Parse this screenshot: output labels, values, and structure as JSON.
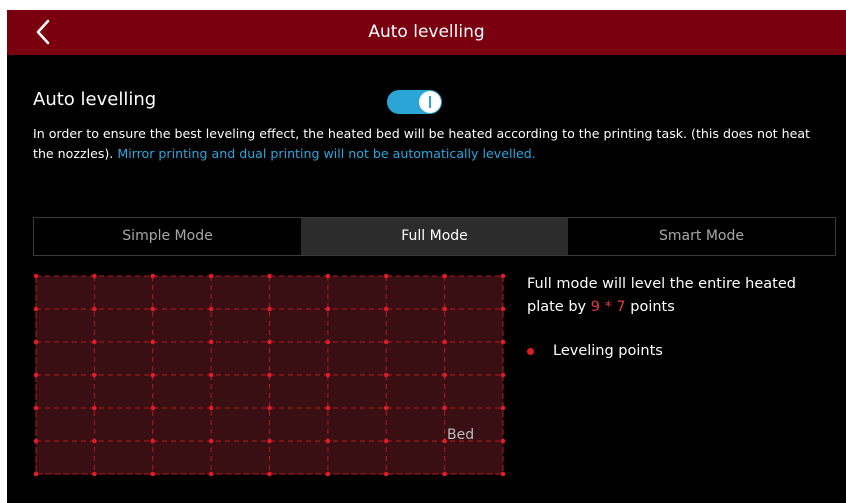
{
  "header": {
    "title": "Auto levelling",
    "back_icon": "chevron-left-icon"
  },
  "auto_levelling": {
    "label": "Auto levelling",
    "toggle_state": "on",
    "toggle_color": "#2aa5d6"
  },
  "description": {
    "text": "In order to ensure the best leveling effect, the heated bed will be heated according to the printing task. (this does not heat the nozzles).",
    "warning": "Mirror printing and dual printing will not be automatically levelled.",
    "warning_color": "#29a8e0"
  },
  "tabs": [
    {
      "label": "Simple Mode",
      "active": false
    },
    {
      "label": "Full Mode",
      "active": true
    },
    {
      "label": "Smart Mode",
      "active": false
    }
  ],
  "bed": {
    "label": "Bed",
    "grid_columns": 9,
    "grid_rows": 7,
    "fill_color": "#3a0f14",
    "point_color": "#e01c26"
  },
  "info": {
    "text_before": "Full mode will level the entire heated plate by",
    "points_text": "9 * 7",
    "text_after": "points"
  },
  "legend": {
    "label": "Leveling points"
  }
}
